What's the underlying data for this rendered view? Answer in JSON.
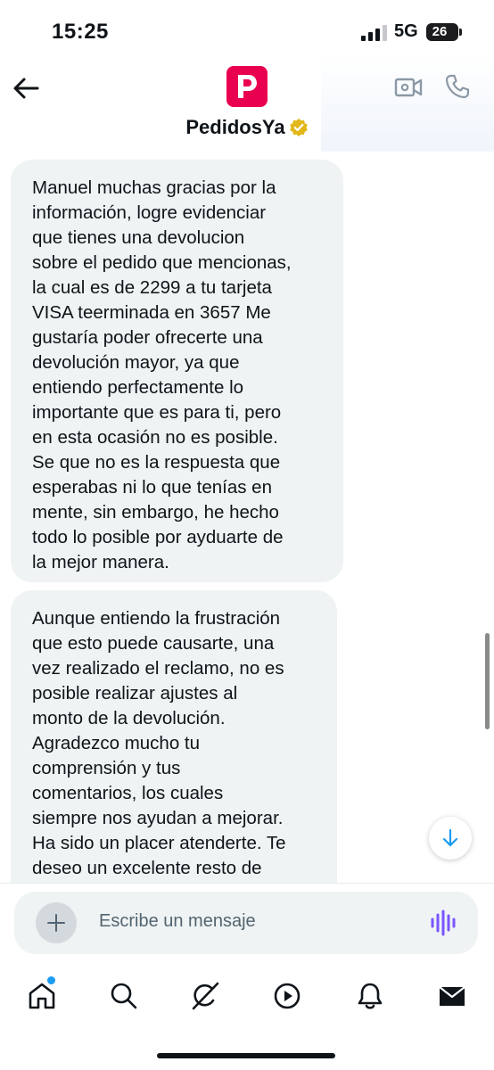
{
  "status_bar": {
    "time": "15:25",
    "network": "5G",
    "battery": "26"
  },
  "header": {
    "title": "PedidosYa",
    "verified": true,
    "brand_color": "#ea0050",
    "icons": [
      "back-arrow-icon",
      "video-call-icon",
      "phone-call-icon",
      "verified-badge-icon"
    ]
  },
  "messages": [
    {
      "sender": "PedidosYa",
      "text": "Manuel muchas gracias por la\ninformación, logre evidenciar\nque tienes una devolucion\nsobre el pedido que mencionas,\nla cual es de 2299 a tu tarjeta\nVISA teerminada en 3657 Me\ngustaría poder ofrecerte una\ndevolución mayor, ya que\nentiendo perfectamente lo\nimportante que es para ti, pero\nen esta ocasión no es posible.\nSe que no es la respuesta que\nesperabas ni lo que tenías en\nmente, sin embargo, he hecho\ntodo lo posible por ayduarte de\nla mejor manera."
    },
    {
      "sender": "PedidosYa",
      "text": "Aunque entiendo la frustración\nque esto puede causarte, una\nvez realizado el reclamo, no es\nposible realizar ajustes al\nmonto de la devolución.\nAgradezco mucho tu\ncomprensión y tus\ncomentarios, los cuales\nsiempre nos ayudan a mejorar.\nHa sido un placer atenderte. Te\ndeseo un excelente resto de\ndía."
    }
  ],
  "composer": {
    "placeholder": "Escribe un mensaje"
  },
  "tabbar": {
    "items": [
      "home-icon",
      "search-icon",
      "grok-icon",
      "video-icon",
      "notifications-icon",
      "messages-icon"
    ],
    "home_has_notification": true
  },
  "colors": {
    "bubble": "#eff3f4",
    "accent": "#1d9bf0",
    "voice": "#7856ff"
  }
}
